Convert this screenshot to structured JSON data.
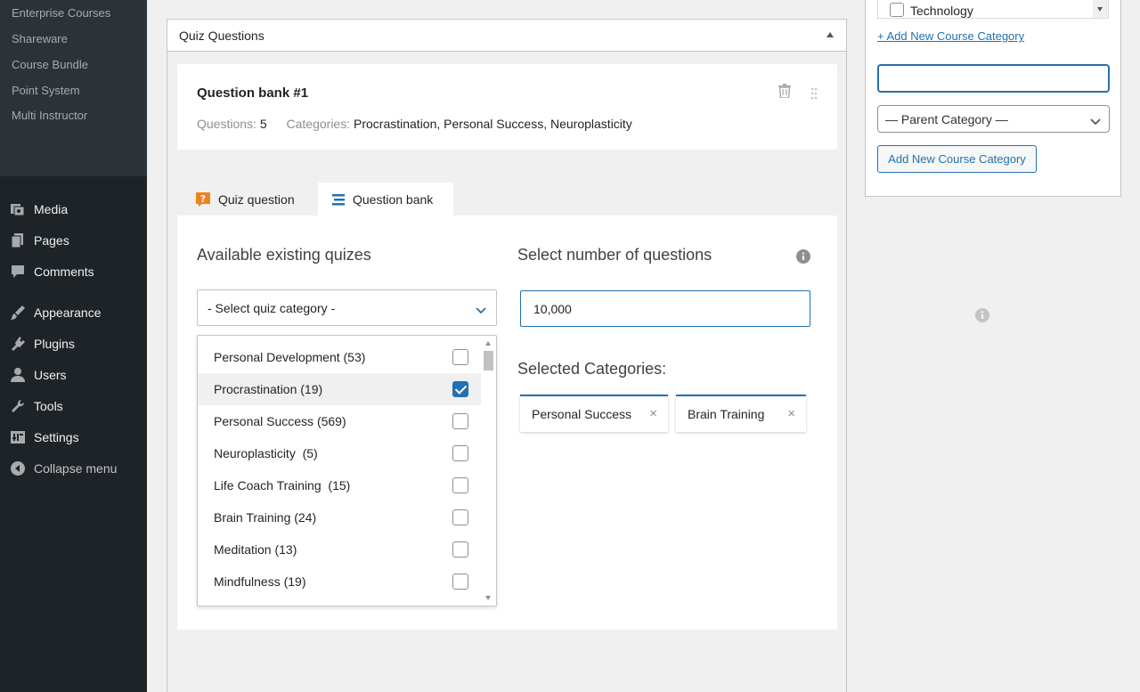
{
  "sidebar": {
    "submenu": [
      "Enterprise Courses",
      "Shareware",
      "Course Bundle",
      "Point System",
      "Multi Instructor"
    ],
    "menu": [
      {
        "label": "Media",
        "icon": "media-icon"
      },
      {
        "label": "Pages",
        "icon": "pages-icon"
      },
      {
        "label": "Comments",
        "icon": "comments-icon"
      },
      {
        "label": "Appearance",
        "icon": "appearance-icon"
      },
      {
        "label": "Plugins",
        "icon": "plugins-icon"
      },
      {
        "label": "Users",
        "icon": "users-icon"
      },
      {
        "label": "Tools",
        "icon": "tools-icon"
      },
      {
        "label": "Settings",
        "icon": "settings-icon"
      }
    ],
    "collapse_label": "Collapse menu"
  },
  "panel": {
    "title": "Quiz Questions"
  },
  "bank": {
    "title": "Question bank #1",
    "questions_label": "Questions:",
    "questions_value": "5",
    "categories_label": "Categories:",
    "categories_value": "Procrastination, Personal Success, Neuroplasticity"
  },
  "tabs": [
    {
      "label": "Quiz question",
      "active": false
    },
    {
      "label": "Question bank",
      "active": true
    }
  ],
  "content": {
    "available_heading": "Available existing quizes",
    "select_heading": "Select number of questions",
    "select_placeholder": "- Select quiz category -",
    "number_value": "10,000",
    "selected_heading": "Selected Categories:",
    "categories": [
      {
        "label": "Personal Development (53)",
        "checked": false
      },
      {
        "label": "Procrastination (19)",
        "checked": true
      },
      {
        "label": "Personal Success (569)",
        "checked": false
      },
      {
        "label": "Neuroplasticity  (5)",
        "checked": false
      },
      {
        "label": "Life Coach Training  (15)",
        "checked": false
      },
      {
        "label": "Brain Training (24)",
        "checked": false
      },
      {
        "label": "Meditation (13)",
        "checked": false
      },
      {
        "label": "Mindfulness (19)",
        "checked": false
      }
    ],
    "selected": [
      "Personal Success",
      "Brain Training"
    ],
    "remove_glyph": "×"
  },
  "right": {
    "technology_label": "Technology",
    "add_link": "+ Add New Course Category",
    "new_category_value": "",
    "parent_select": "— Parent Category —",
    "add_button": "Add New Course Category"
  },
  "colors": {
    "accent": "#2271b1",
    "sidebar_bg": "#1d2327",
    "quiz_icon": "#f0821e"
  }
}
